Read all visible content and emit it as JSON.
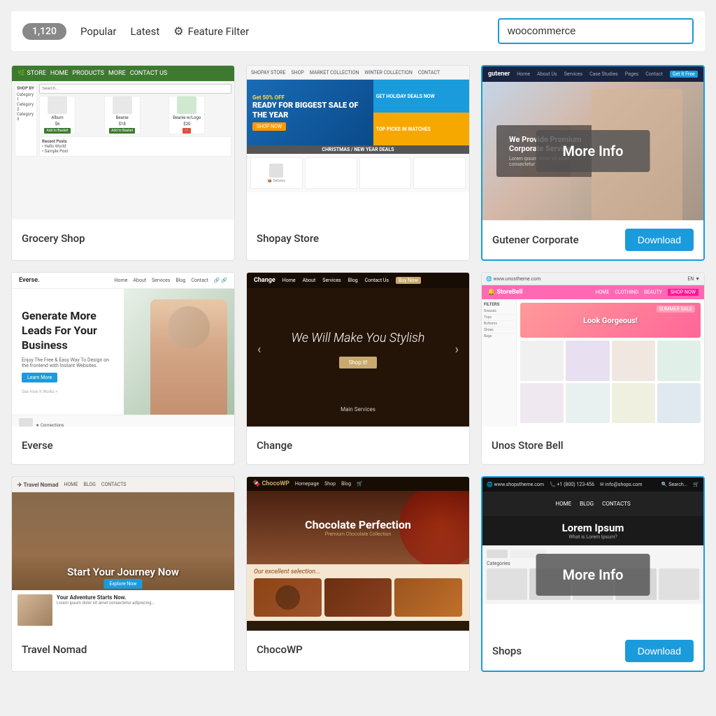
{
  "topbar": {
    "count": "1,120",
    "popular_label": "Popular",
    "latest_label": "Latest",
    "feature_filter_label": "Feature Filter",
    "search_placeholder": "woocommerce",
    "search_value": "woocommerce"
  },
  "cards": [
    {
      "id": "grocery-shop",
      "title": "Grocery Shop",
      "highlighted": false,
      "has_download": false,
      "has_more_info": false,
      "download_label": "",
      "more_info_label": ""
    },
    {
      "id": "shopay-store",
      "title": "Shopay Store",
      "highlighted": false,
      "has_download": false,
      "has_more_info": false,
      "download_label": "",
      "more_info_label": ""
    },
    {
      "id": "gutener-corporate",
      "title": "Gutener Corporate",
      "highlighted": true,
      "has_download": true,
      "has_more_info": true,
      "download_label": "Download",
      "more_info_label": "More Info"
    },
    {
      "id": "everse",
      "title": "Everse",
      "highlighted": false,
      "has_download": false,
      "has_more_info": false,
      "download_label": "",
      "more_info_label": ""
    },
    {
      "id": "change",
      "title": "Change",
      "highlighted": false,
      "has_download": false,
      "has_more_info": false,
      "download_label": "",
      "more_info_label": ""
    },
    {
      "id": "unos-store-bell",
      "title": "Unos Store Bell",
      "highlighted": false,
      "has_download": false,
      "has_more_info": false,
      "download_label": "",
      "more_info_label": ""
    },
    {
      "id": "travel-nomad",
      "title": "Travel Nomad",
      "highlighted": false,
      "has_download": false,
      "has_more_info": false,
      "download_label": "",
      "more_info_label": ""
    },
    {
      "id": "chocowp",
      "title": "ChocoWP",
      "highlighted": false,
      "has_download": false,
      "has_more_info": false,
      "download_label": "",
      "more_info_label": ""
    },
    {
      "id": "shops",
      "title": "Shops",
      "highlighted": true,
      "has_download": true,
      "has_more_info": true,
      "download_label": "Download",
      "more_info_label": "More Info"
    }
  ],
  "preview_texts": {
    "grocery_store_name": "STORE",
    "shopay_sale": "GET 50% OFF",
    "shopay_big": "READY FOR BIGGEST SALE OF THE YEAR",
    "shopay_holiday": "GET HOLIDAY DEALS NOW",
    "shopay_top": "TOP PICKS IN WATCHES",
    "shopay_banner": "CHRISTMAS / NEW YEAR DEALS",
    "gutener_brand": "gutener",
    "gutener_tagline": "We Provide Premium Corporate Service",
    "everse_brand": "Everse",
    "everse_headline": "Generate More Leads For Your Business",
    "everse_sub": "Enjoy The Free & Easy Way To Design on the frontend with Instant Websites.",
    "change_brand": "Change",
    "change_slogan": "We Will Make You Stylish",
    "unos_brand": "StoreBell",
    "unos_banner": "Look Gorgeous!",
    "travel_hero": "Start Your Journey Now",
    "travel_sub_title": "Your Adventure Starts Now.",
    "choco_title": "Chocolate Perfection",
    "choco_sub": "Our excellent selection...",
    "shops_title": "Lorem Ipsum",
    "shops_sub": "What is Lorem Ipsum?"
  }
}
